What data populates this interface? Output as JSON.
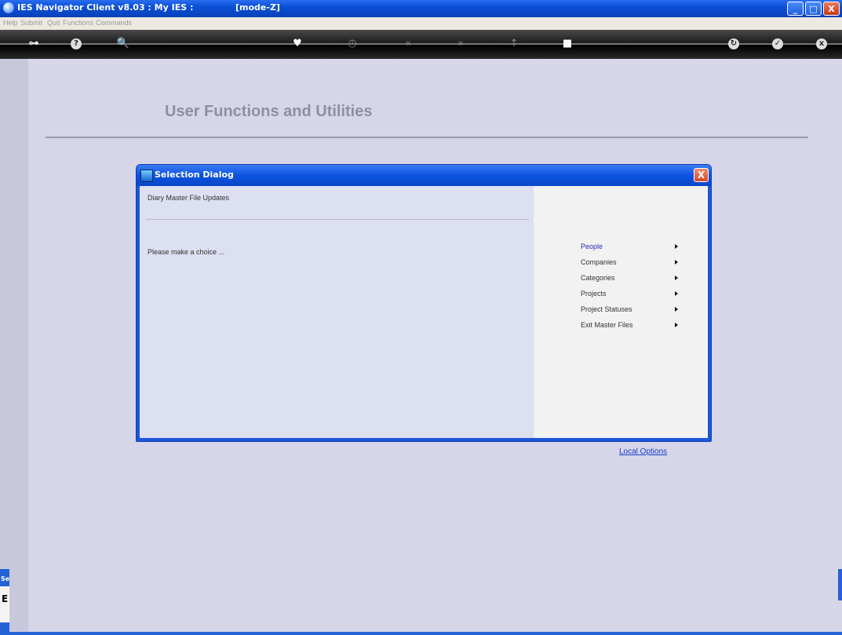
{
  "window": {
    "title": "IES Navigator Client v8.03 : My IES :",
    "mode": "[mode-Z]"
  },
  "window_buttons": {
    "minimize": "_",
    "maximize": "□",
    "close": "X"
  },
  "menubar": {
    "items": [
      "Help",
      "Submit",
      "Quit",
      "Functions",
      "Commands"
    ]
  },
  "toolbar": {
    "icons": [
      {
        "name": "key-icon",
        "glyph": "⊶"
      },
      {
        "name": "help-icon",
        "glyph": "?"
      },
      {
        "name": "search-icon",
        "glyph": "🔍"
      },
      {
        "name": "heart-icon",
        "glyph": "♥"
      },
      {
        "name": "clock-icon",
        "glyph": "◷"
      },
      {
        "name": "rewind-icon",
        "glyph": "«"
      },
      {
        "name": "forward-icon",
        "glyph": "»"
      },
      {
        "name": "up-icon",
        "glyph": "↑"
      },
      {
        "name": "stop-icon",
        "glyph": "■"
      },
      {
        "name": "refresh-icon",
        "glyph": "↻"
      },
      {
        "name": "confirm-icon",
        "glyph": "✓"
      },
      {
        "name": "cancel-icon",
        "glyph": "x"
      }
    ]
  },
  "page": {
    "heading": "User Functions and Utilities"
  },
  "dialog": {
    "title": "Selection Dialog",
    "close_label": "X",
    "subtitle": "Diary Master File Updates",
    "prompt": "Please make a choice ...",
    "choices": [
      "People",
      "Companies",
      "Categories",
      "Projects",
      "Project Statuses",
      "Exit Master Files"
    ]
  },
  "local_options": "Local Options",
  "side_tab": {
    "label": "Se",
    "box_text": "E"
  }
}
